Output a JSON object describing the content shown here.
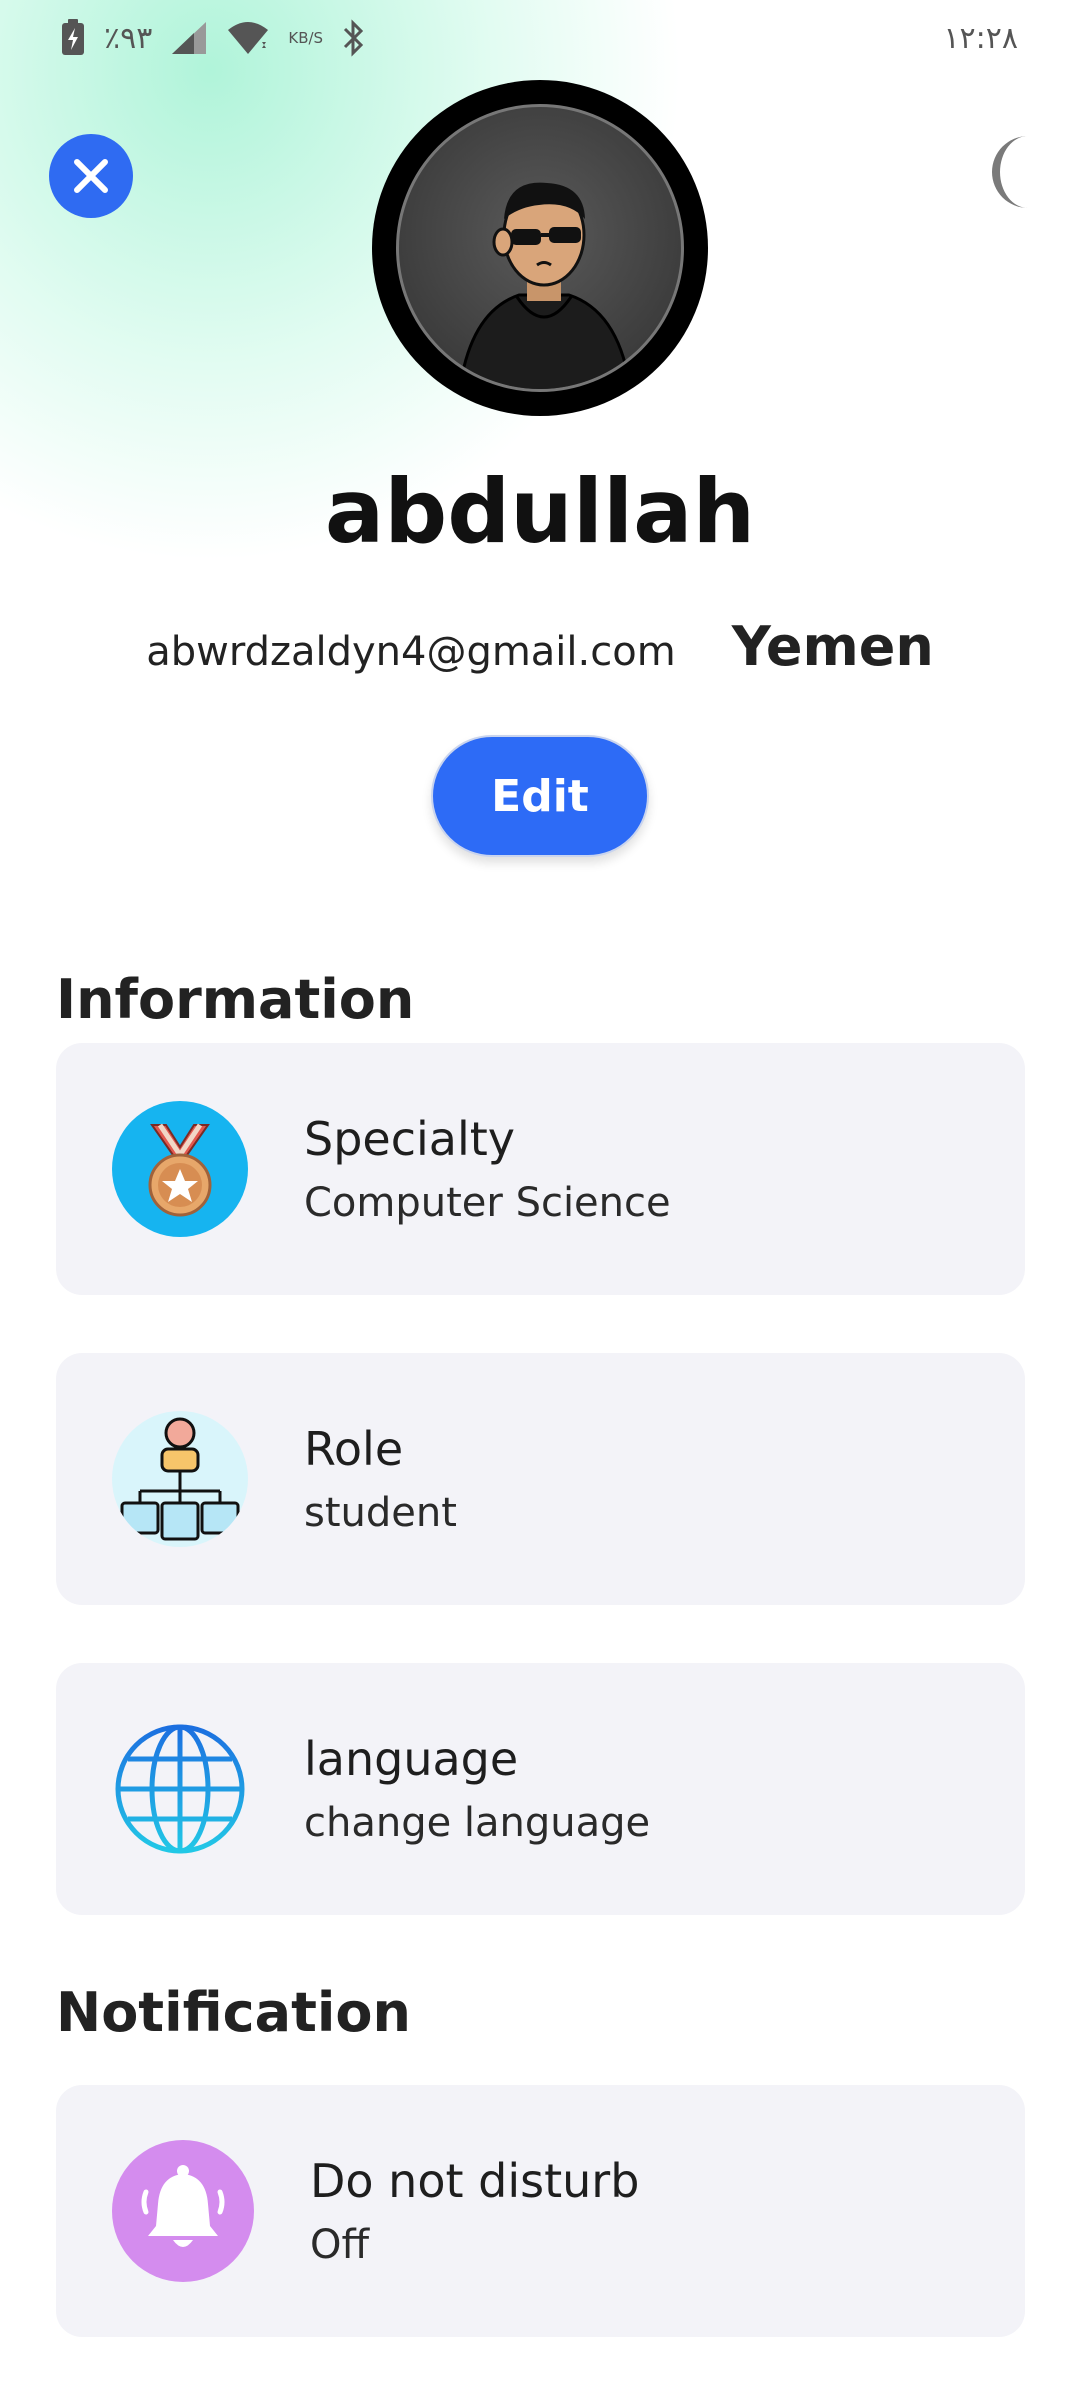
{
  "status_bar": {
    "battery_percent": "٪٩٣",
    "speed_unit": "KB/S",
    "time": "١٢:٢٨"
  },
  "header": {
    "close_icon": "close-icon",
    "theme_icon": "moon-icon"
  },
  "profile": {
    "name": "abdullah",
    "email": "abwrdzaldyn4@gmail.com",
    "country": "Yemen",
    "edit_label": "Edit"
  },
  "information": {
    "title": "Information",
    "items": [
      {
        "title": "Specialty",
        "subtitle": "Computer Science",
        "icon": "medal-icon"
      },
      {
        "title": "Role",
        "subtitle": "student",
        "icon": "org-chart-icon"
      },
      {
        "title": "language",
        "subtitle": "change language",
        "icon": "globe-icon"
      }
    ]
  },
  "notification": {
    "title": "Notification",
    "items": [
      {
        "title": "Do not disturb",
        "subtitle": "Off",
        "icon": "bell-icon"
      }
    ]
  },
  "colors": {
    "accent": "#2d6bf6",
    "card_bg": "#f3f3f8",
    "mint": "#b8f5dc"
  }
}
